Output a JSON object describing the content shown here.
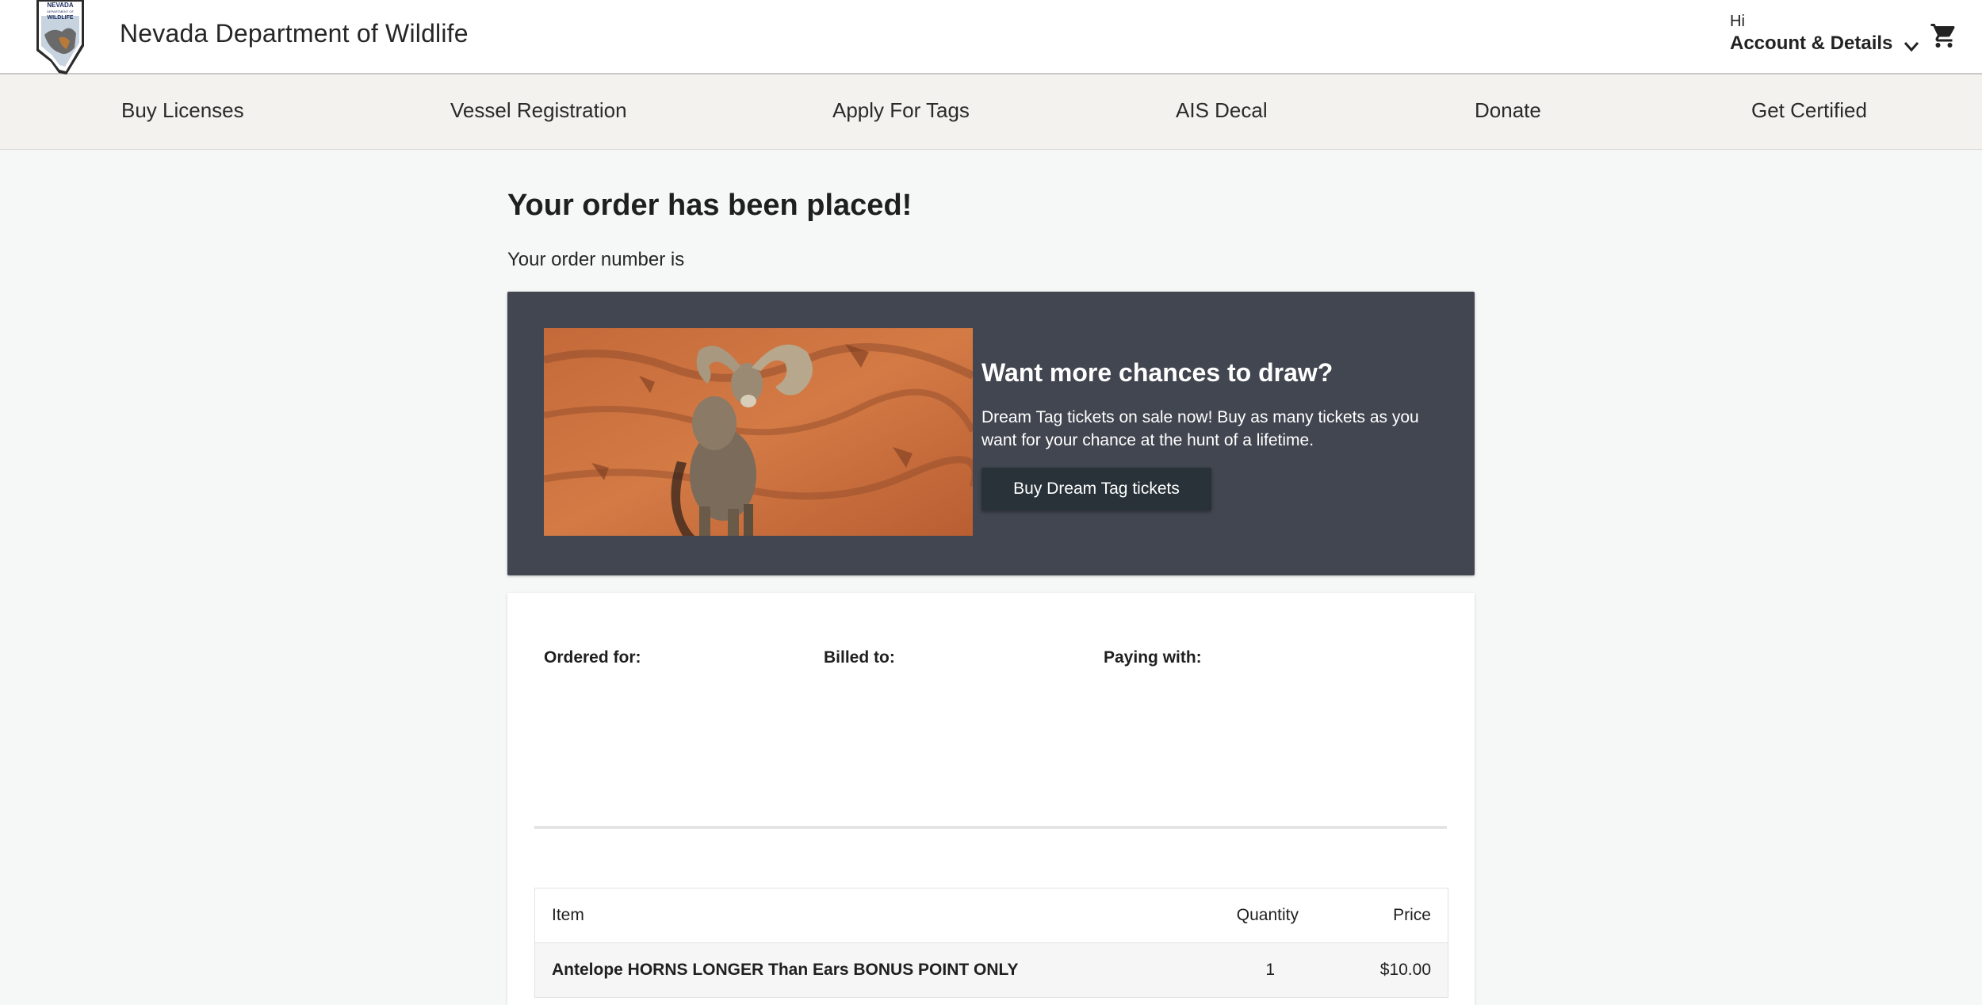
{
  "header": {
    "title": "Nevada Department of Wildlife",
    "logo": {
      "name": "ndow-shield-logo",
      "lettering": [
        "NEVADA",
        "WILDLIFE"
      ]
    },
    "account": {
      "greeting": "Hi",
      "label": "Account & Details",
      "icon": "chevron-down-icon"
    },
    "cart_icon": "shopping-cart-icon"
  },
  "nav": {
    "items": [
      {
        "label": "Buy Licenses"
      },
      {
        "label": "Vessel Registration"
      },
      {
        "label": "Apply For Tags"
      },
      {
        "label": "AIS Decal"
      },
      {
        "label": "Donate"
      },
      {
        "label": "Get Certified"
      }
    ]
  },
  "main": {
    "title": "Your order has been placed!",
    "order_number_label": "Your order number is"
  },
  "promo": {
    "image": "bighorn-sheep-photo",
    "title": "Want more chances to draw?",
    "text": "Dream Tag tickets on sale now! Buy as many tickets as you want for your chance at the hunt of a lifetime.",
    "button": "Buy Dream Tag tickets"
  },
  "details": {
    "ordered_for": "Ordered for:",
    "billed_to": "Billed to:",
    "paying_with": "Paying with:"
  },
  "items": {
    "headers": [
      "Item",
      "Quantity",
      "Price"
    ],
    "rows": [
      {
        "item": "Antelope HORNS LONGER Than Ears BONUS POINT ONLY",
        "quantity": "1",
        "price": "$10.00"
      }
    ]
  },
  "colors": {
    "nav_bg": "#f4f2ef",
    "promo_bg": "#424650",
    "promo_button": "#283238",
    "page_bg": "#f6f7f7"
  }
}
